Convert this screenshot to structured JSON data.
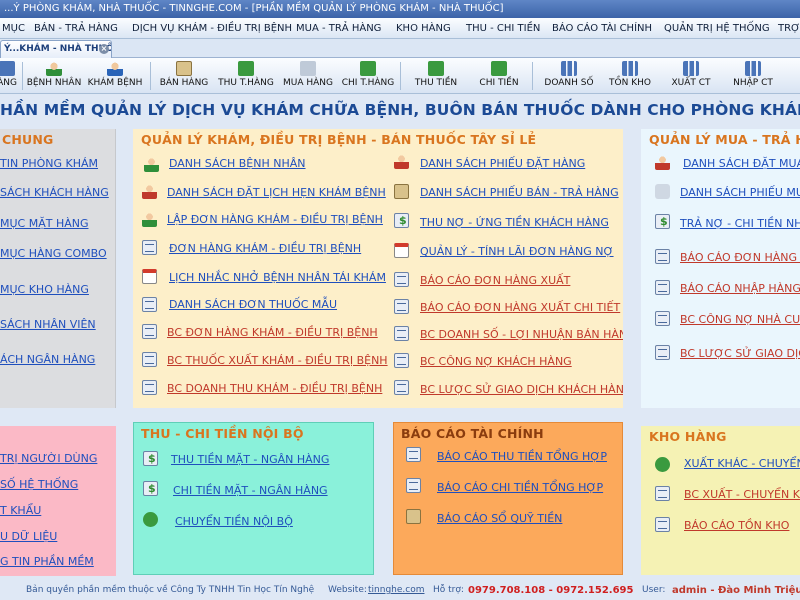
{
  "window": {
    "title": "...Ý PHÒNG KHÁM, NHÀ THUỐC - TINNGHE.COM - [PHẦN MỀM QUẢN LÝ PHÒNG KHÁM - NHÀ THUỐC]"
  },
  "menu": [
    "MỤC",
    "BÁN - TRẢ HÀNG",
    "DỊCH VỤ KHÁM - ĐIỀU TRỊ BỆNH",
    "MUA - TRẢ HÀNG",
    "KHO HÀNG",
    "THU - CHI TIỀN",
    "BÁO CÁO TÀI CHÍNH",
    "QUẢN TRỊ HỆ THỐNG",
    "TRỢ"
  ],
  "tab": {
    "label": "Ý...KHÁM - NHÀ THUỐC",
    "close": "×"
  },
  "toolbar": [
    "ÀNG",
    "BỆNH NHÂN",
    "KHÁM BỆNH",
    "BÁN HÀNG",
    "THU T.HÀNG",
    "MUA HÀNG",
    "CHI T.HÀNG",
    "THU TIỀN",
    "CHI TIỀN",
    "DOANH SỐ",
    "TỒN KHO",
    "XUẤT CT",
    "NHẬP CT"
  ],
  "banner": "HẦN MỀM QUẢN LÝ DỊCH VỤ KHÁM CHỮA BỆNH, BUÔN BÁN THUỐC DÀNH CHO PHÒNG KHÁM -  NHÀ THUỐC",
  "panels": {
    "chung": {
      "title": "CHUNG",
      "items": [
        "TIN PHÒNG KHÁM",
        "SÁCH KHÁCH HÀNG",
        "MỤC MẶT HÀNG",
        "MỤC HÀNG COMBO",
        "MỤC KHO HÀNG",
        "SÁCH NHÂN VIÊN",
        "ÁCH NGÂN HÀNG"
      ]
    },
    "kham": {
      "title": "QUẢN LÝ KHÁM, ĐIỀU TRỊ BỆNH - BÁN THUỐC TÂY SỈ LẺ",
      "col1": [
        "DANH SÁCH BỆNH NHÂN",
        "DANH SÁCH ĐẶT LỊCH HẸN KHÁM BỆNH",
        "LẬP ĐƠN HÀNG KHÁM - ĐIỀU TRỊ BỆNH",
        "ĐƠN HÀNG KHÁM - ĐIỀU TRỊ BỆNH",
        "LỊCH NHẮC NHỞ BỆNH NHÂN TÁI KHÁM",
        "DANH SÁCH ĐƠN THUỐC MẪU",
        "BC ĐƠN HÀNG KHÁM - ĐIỀU TRỊ BỆNH",
        "BC THUỐC XUẤT KHÁM - ĐIỀU TRỊ BỆNH",
        "BC DOANH THU KHÁM - ĐIỀU TRỊ BỆNH"
      ],
      "col2": [
        "DANH SÁCH PHIẾU ĐẶT HÀNG",
        "DANH SÁCH PHIẾU BÁN - TRẢ HÀNG",
        "THU NỢ - ỨNG TIỀN KHÁCH HÀNG",
        "QUẢN LÝ - TÍNH LÃI ĐƠN HÀNG NỢ",
        "BÁO CÁO ĐƠN HÀNG XUẤT",
        "BÁO CÁO ĐƠN HÀNG XUẤT CHI TIẾT",
        "BC DOANH SỐ - LỢI NHUẬN BÁN HÀNG",
        "BC CÔNG NỢ KHÁCH HÀNG",
        "BC LƯỢC SỬ GIAO DỊCH KHÁCH HÀNG"
      ]
    },
    "mua": {
      "title": "QUẢN LÝ MUA - TRẢ H",
      "items": [
        "DANH SÁCH ĐẶT MUA H",
        "DANH SÁCH PHIẾU MUA",
        "TRẢ NỢ - CHI TIỀN NHÀ",
        "BÁO CÁO ĐƠN HÀNG NH",
        "BÁO CÁO NHẬP HÀNG C",
        "BC CÔNG NỢ NHÀ CUNG",
        "BC LƯỢC SỬ GIAO DỊCH"
      ]
    },
    "quantri": {
      "title": "",
      "items": [
        "TRỊ NGƯỜI DÙNG",
        "SỐ HỆ THỐNG",
        "T KHẨU",
        "U DỮ LIỆU",
        "G TIN PHẦN MỀM"
      ]
    },
    "thuchi": {
      "title": "THU - CHI TIỀN NỘI BỘ",
      "items": [
        "THU TIỀN MẶT - NGÂN HÀNG",
        "CHI TIỀN MẶT - NGÂN HÀNG",
        "CHUYỂN TIỀN NỘI BỘ"
      ]
    },
    "baocao": {
      "title": "BÁO CÁO TÀI CHÍNH",
      "items": [
        "BÁO CÁO THU TIỀN TỔNG HỢP",
        "BÁO CÁO CHI TIỀN TỔNG HỢP",
        "BÁO CÁO SỔ QUỸ TIỀN"
      ]
    },
    "kho": {
      "title": "KHO HÀNG",
      "items": [
        "XUẤT KHÁC - CHUYỂN K",
        "BC XUẤT - CHUYỂN KHO",
        "BÁO CÁO TỒN KHO"
      ]
    }
  },
  "footer": {
    "copyright": "Bản quyền phần mềm thuộc về Công Ty TNHH Tin Học Tín Nghệ",
    "website_label": "Website:",
    "website": "tinnghe.com",
    "support_label": "Hỗ trợ:",
    "phones": "0979.708.108 - 0972.152.695",
    "user_label": "User:",
    "user": "admin - Đào Minh Triệu"
  },
  "colors": {
    "banner": "#1c4a95",
    "panel_chung": "#dcdde0",
    "panel_kham": "#fdefc9",
    "panel_mua": "#eaf6fd",
    "panel_quantri": "#fbb9c6",
    "panel_thuchi": "#8af1da",
    "panel_baocao": "#fca95b",
    "panel_kho": "#f5f2b4",
    "title_orange": "#d9751f",
    "link_blue": "#1f4fbd",
    "link_red": "#c0392b"
  }
}
